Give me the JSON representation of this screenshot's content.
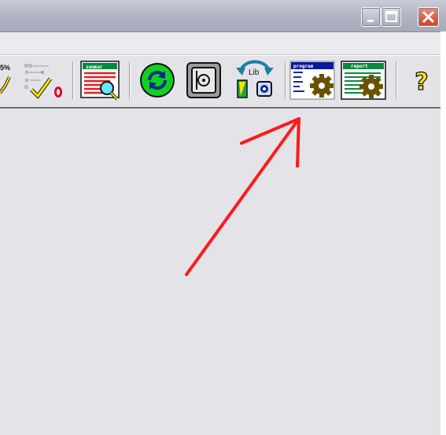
{
  "window": {
    "buttons": [
      "minimize",
      "maximize",
      "close"
    ]
  },
  "toolbar": {
    "items": [
      {
        "name": "percent-check-tool",
        "label": "5%"
      },
      {
        "name": "checklist-tool"
      },
      {
        "name": "summary-tool",
        "label": "summar"
      },
      {
        "name": "refresh-tool"
      },
      {
        "name": "safe-tool"
      },
      {
        "name": "library-tool",
        "label": "Lib"
      },
      {
        "name": "program-tool",
        "label": "program"
      },
      {
        "name": "report-tool",
        "label": "report"
      },
      {
        "name": "help-tool",
        "label": "?"
      }
    ]
  },
  "annotation": {
    "color": "#ff1a1a",
    "points_to": "program-tool"
  }
}
